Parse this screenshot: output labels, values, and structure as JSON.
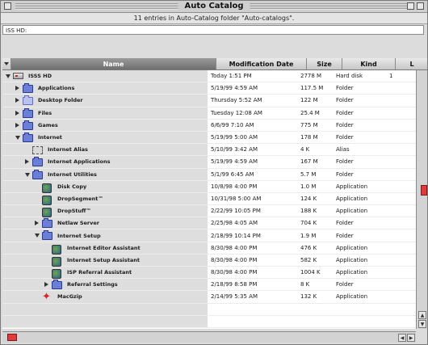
{
  "window": {
    "title": "Auto Catalog",
    "info": "11 entries in Auto-Catalog folder \"Auto-catalogs\".",
    "path": "ISS HD:"
  },
  "columns": {
    "name": "Name",
    "date": "Modification Date",
    "size": "Size",
    "kind": "Kind",
    "extra": "L"
  },
  "rows": [
    {
      "name": "ISSS HD",
      "date": "Today 1:51 PM",
      "size": "2778 M",
      "kind": "Hard disk",
      "extra": "1"
    },
    {
      "name": "Applications",
      "date": "5/19/99 4:59 AM",
      "size": "117.5 M",
      "kind": "Folder",
      "extra": ""
    },
    {
      "name": "Desktop Folder",
      "date": "Thursday 5:52 AM",
      "size": "122 M",
      "kind": "Folder",
      "extra": ""
    },
    {
      "name": "Files",
      "date": "Tuesday 12:08 AM",
      "size": "25.4 M",
      "kind": "Folder",
      "extra": ""
    },
    {
      "name": "Games",
      "date": "6/6/99 7:10 AM",
      "size": "775 M",
      "kind": "Folder",
      "extra": ""
    },
    {
      "name": "Internet",
      "date": "5/19/99 5:00 AM",
      "size": "178 M",
      "kind": "Folder",
      "extra": ""
    },
    {
      "name": "Internet Alias",
      "date": "5/10/99 3:42 AM",
      "size": "4 K",
      "kind": "Alias",
      "extra": ""
    },
    {
      "name": "Internet Applications",
      "date": "5/19/99 4:59 AM",
      "size": "167 M",
      "kind": "Folder",
      "extra": ""
    },
    {
      "name": "Internet Utilities",
      "date": "5/1/99 6:45 AM",
      "size": "5.7 M",
      "kind": "Folder",
      "extra": ""
    },
    {
      "name": "Disk Copy",
      "date": "10/8/98 4:00 PM",
      "size": "1.0 M",
      "kind": "Application",
      "extra": ""
    },
    {
      "name": "DropSegment™",
      "date": "10/31/98 5:00 AM",
      "size": "124 K",
      "kind": "Application",
      "extra": ""
    },
    {
      "name": "DropStuff™",
      "date": "2/22/99 10:05 PM",
      "size": "188 K",
      "kind": "Application",
      "extra": ""
    },
    {
      "name": "Netlaw Server",
      "date": "2/25/98 4:05 AM",
      "size": "704 K",
      "kind": "Folder",
      "extra": ""
    },
    {
      "name": "Internet Setup",
      "date": "2/18/99 10:14 PM",
      "size": "1.9 M",
      "kind": "Folder",
      "extra": ""
    },
    {
      "name": "Internet Editor Assistant",
      "date": "8/30/98 4:00 PM",
      "size": "476 K",
      "kind": "Application",
      "extra": ""
    },
    {
      "name": "Internet Setup Assistant",
      "date": "8/30/98 4:00 PM",
      "size": "582 K",
      "kind": "Application",
      "extra": ""
    },
    {
      "name": "ISP Referral Assistant",
      "date": "8/30/98 4:00 PM",
      "size": "1004 K",
      "kind": "Application",
      "extra": ""
    },
    {
      "name": "Referral Settings",
      "date": "2/18/99 8:58 PM",
      "size": "8 K",
      "kind": "Folder",
      "extra": ""
    },
    {
      "name": "MacGzip",
      "date": "2/14/99 5:35 AM",
      "size": "132 K",
      "kind": "Application",
      "extra": ""
    },
    {
      "name": "",
      "date": "",
      "size": "",
      "kind": "",
      "extra": ""
    },
    {
      "name": "",
      "date": "",
      "size": "",
      "kind": "",
      "extra": ""
    }
  ],
  "icons": {
    "disk": "hard-disk-icon",
    "folder": "folder-icon",
    "alias": "alias-icon",
    "app": "application-icon"
  },
  "colors": {
    "scroll_thumb": "#e23a3a",
    "folder": "#6b7fd9"
  }
}
